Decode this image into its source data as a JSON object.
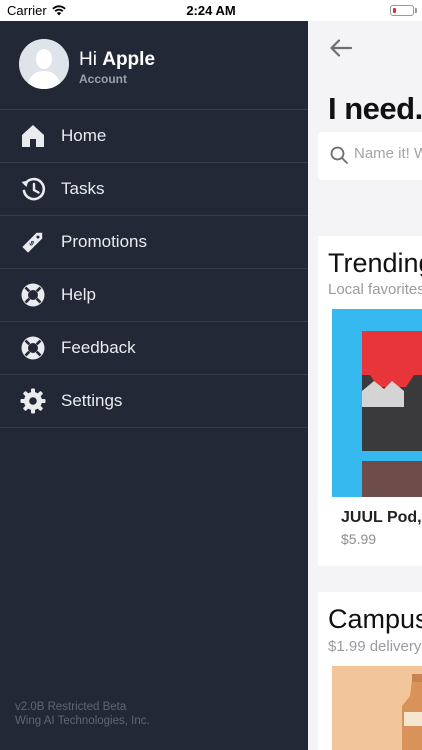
{
  "status_bar": {
    "carrier": "Carrier",
    "time": "2:24 AM",
    "battery_level": 0.2,
    "battery_color": "#e0312f"
  },
  "drawer": {
    "greeting_prefix": "Hi",
    "user_name": "Apple",
    "account_label": "Account",
    "menu": [
      {
        "label": "Home",
        "icon": "home-icon"
      },
      {
        "label": "Tasks",
        "icon": "history-icon"
      },
      {
        "label": "Promotions",
        "icon": "price-tag-icon"
      },
      {
        "label": "Help",
        "icon": "lifebuoy-icon"
      },
      {
        "label": "Feedback",
        "icon": "lifebuoy-icon"
      },
      {
        "label": "Settings",
        "icon": "gear-icon"
      }
    ],
    "version_line1": "v2.0B Restricted Beta",
    "version_line2": "Wing AI Technologies, Inc."
  },
  "content": {
    "title": "I need...",
    "search_placeholder": "Name it! W",
    "sections": [
      {
        "title": "Trending",
        "subtitle": "Local favorites",
        "product": {
          "name": "JUUL Pod,",
          "price": "$5.99"
        }
      },
      {
        "title": "Campus",
        "subtitle": "$1.99 delivery"
      }
    ]
  },
  "colors": {
    "drawer_bg": "#232836",
    "divider": "#363c4a",
    "product_bg": "#36b9ee"
  }
}
